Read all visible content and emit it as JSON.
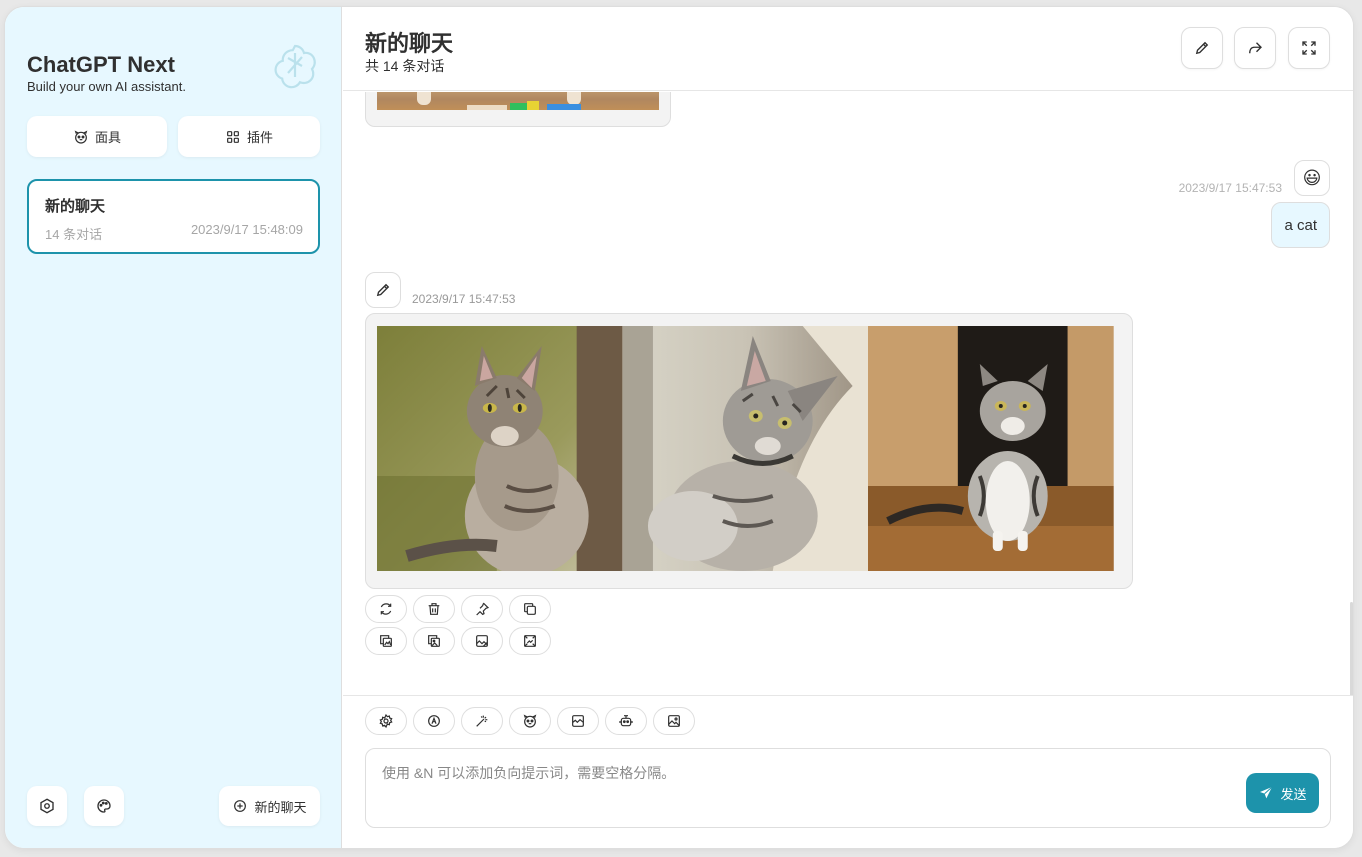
{
  "sidebar": {
    "title": "ChatGPT Next",
    "subtitle": "Build your own AI assistant.",
    "masks_label": "面具",
    "plugins_label": "插件",
    "chat_items": [
      {
        "title": "新的聊天",
        "count": "14 条对话",
        "date": "2023/9/17 15:48:09"
      }
    ],
    "new_chat_label": "新的聊天"
  },
  "header": {
    "title": "新的聊天",
    "subtitle": "共 14 条对话"
  },
  "messages": {
    "user": {
      "avatar": "😃",
      "date": "2023/9/17 15:47:53",
      "text": "a cat"
    },
    "bot": {
      "date": "2023/9/17 15:47:53"
    }
  },
  "input": {
    "placeholder": "使用 &N 可以添加负向提示词，需要空格分隔。",
    "send_label": "发送"
  },
  "colors": {
    "accent": "#1d93ab",
    "sidebar_bg": "#e7f8ff",
    "user_bubble": "#e7f8ff"
  }
}
